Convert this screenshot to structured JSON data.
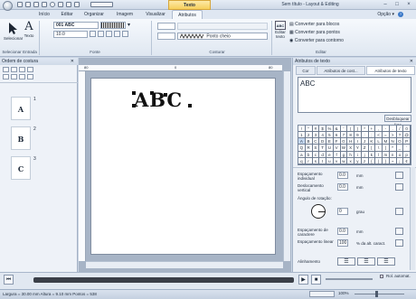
{
  "title_bar": {
    "context_tab": "Texto",
    "app_title": "Sem título - Layout & Editing",
    "min": "–",
    "max": "□",
    "close": "×"
  },
  "tabs": [
    "Início",
    "Editar",
    "Organizar",
    "Imagem",
    "Visualizar",
    "Atributos"
  ],
  "options": {
    "label": "Opção",
    "dropdown": "▾"
  },
  "ribbon": {
    "select_label": "Selecionar",
    "text_label": "Texto",
    "font_name": "001 ABC",
    "font_size": "10.0",
    "stitch_label": "Ponto cheio",
    "convert_blocks": "Converter para blocos",
    "convert_points": "Converter para pontos",
    "convert_contour": "Converter para contorno",
    "edit_text": "Editar texto",
    "groups": [
      "Selecionar",
      "Entrada",
      "Fonte",
      "Costurar",
      "Editar"
    ]
  },
  "left_panel": {
    "title": "Ordem de costura",
    "items": [
      {
        "letter": "A",
        "num": "1"
      },
      {
        "letter": "B",
        "num": "2"
      },
      {
        "letter": "C",
        "num": "3"
      }
    ]
  },
  "canvas": {
    "text": "ABC",
    "ruler_top": [
      "80",
      "0",
      "80"
    ]
  },
  "right_panel": {
    "title": "Atributos de texto",
    "tabs": [
      "Cor",
      "Atributos de cost...",
      "Atributos de texto"
    ],
    "text_value": "ABC",
    "unlock_label": "Desbloquear lista",
    "charmap": [
      "!",
      "\"",
      "#",
      "$",
      "%",
      "&",
      "'",
      "(",
      ")",
      "*",
      "+",
      ",",
      "-",
      ".",
      "/",
      "0",
      "1",
      "2",
      "3",
      "4",
      "5",
      "6",
      "7",
      "8",
      "9",
      ":",
      ";",
      "<",
      "=",
      ">",
      "?",
      "@",
      "A",
      "B",
      "C",
      "D",
      "E",
      "F",
      "G",
      "H",
      "I",
      "J",
      "K",
      "L",
      "M",
      "N",
      "O",
      "P",
      "Q",
      "R",
      "S",
      "T",
      "U",
      "V",
      "W",
      "X",
      "Y",
      "Z",
      "[",
      "\\",
      "]",
      "^",
      "_",
      "`",
      "a",
      "b",
      "c",
      "d",
      "e",
      "f",
      "g",
      "h",
      "i",
      "j",
      "k",
      "l",
      "m",
      "n",
      "o",
      "p",
      "q",
      "r",
      "s",
      "t",
      "u",
      "v",
      "w",
      "x",
      "y",
      "z",
      "{",
      "|",
      "}",
      "~",
      "¡",
      "¢"
    ],
    "props": {
      "spacing_label": "Espaçamento individual",
      "spacing_value": "0.0",
      "offset_label": "Deslocamento vertical",
      "offset_value": "0.0",
      "rotation_label": "Ângulo de rotação:",
      "rotation_value": "0",
      "rotation_unit": "grau",
      "char_spacing_label": "Espaçamento de caractere",
      "char_spacing_value": "0.0",
      "line_spacing_label": "Espaçamento linear",
      "line_spacing_value": "100",
      "line_spacing_unit": "% da alt. caract.",
      "mm": "mm",
      "align_label": "Alinhamento"
    }
  },
  "playback": {
    "auto_label": "Rol. automat."
  },
  "status": {
    "text": "Largura = 30.00 mm  Altura = 9.10 mm  Pontos = 538",
    "zoom": "100%"
  }
}
